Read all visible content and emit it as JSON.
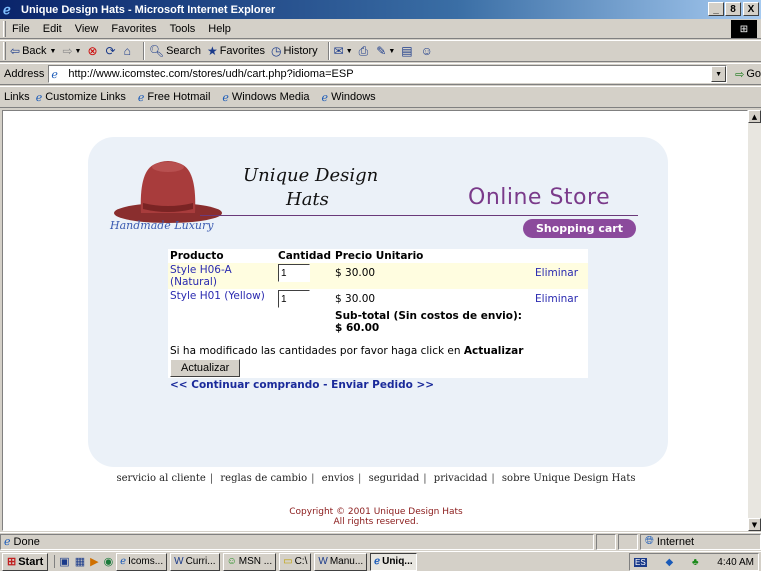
{
  "window": {
    "title": "Unique Design Hats - Microsoft Internet Explorer",
    "min": "_",
    "max": "8",
    "close": "X"
  },
  "menu": [
    "File",
    "Edit",
    "View",
    "Favorites",
    "Tools",
    "Help"
  ],
  "toolbar": {
    "back": "Back",
    "search": "Search",
    "favorites": "Favorites",
    "history": "History"
  },
  "address": {
    "label": "Address",
    "url": "http://www.icomstec.com/stores/udh/cart.php?idioma=ESP",
    "go": "Go"
  },
  "links": {
    "label": "Links",
    "items": [
      "Customize Links",
      "Free Hotmail",
      "Windows Media",
      "Windows"
    ]
  },
  "page": {
    "brand_line1": "Unique Design",
    "brand_line2": "Hats",
    "online_store": "Online Store",
    "tagline": "Handmade Luxury",
    "shopping_cart": "Shopping cart",
    "table": {
      "headers": [
        "Producto",
        "Cantidad",
        "Precio Unitario"
      ],
      "rows": [
        {
          "product": "Style H06-A (Natural)",
          "qty": "1",
          "price": "$ 30.00",
          "remove": "Eliminar"
        },
        {
          "product": "Style H01 (Yellow)",
          "qty": "1",
          "price": "$ 30.00",
          "remove": "Eliminar"
        }
      ],
      "subtotal_label": "Sub-total (Sin costos de envio):",
      "subtotal_value": "$ 60.00"
    },
    "update_msg": "Si ha modificado las cantidades por favor haga click en",
    "update_word": "Actualizar",
    "update_button": "Actualizar",
    "nav_link": "<< Continuar comprando - Enviar Pedido >>",
    "footer_links": [
      "servicio al cliente",
      "reglas de cambio",
      "envios",
      "seguridad",
      "privacidad",
      "sobre Unique Design Hats"
    ],
    "copyright_line1": "Copyright © 2001 Unique Design Hats",
    "copyright_line2": "All rights reserved."
  },
  "status": {
    "text": "Done",
    "zone": "Internet"
  },
  "taskbar": {
    "start": "Start",
    "tasks": [
      "Icoms...",
      "Curri...",
      "MSN ...",
      "C:\\",
      "Manu...",
      "Uniq..."
    ],
    "clock": "4:40 AM",
    "lang": "ES"
  },
  "colors": {
    "panel_bg": "#ebf1f8",
    "accent_purple": "#8b4a9c",
    "link_blue": "#2a2ab0",
    "row_highlight": "#fffde0",
    "hat_red": "#a83c3c"
  }
}
